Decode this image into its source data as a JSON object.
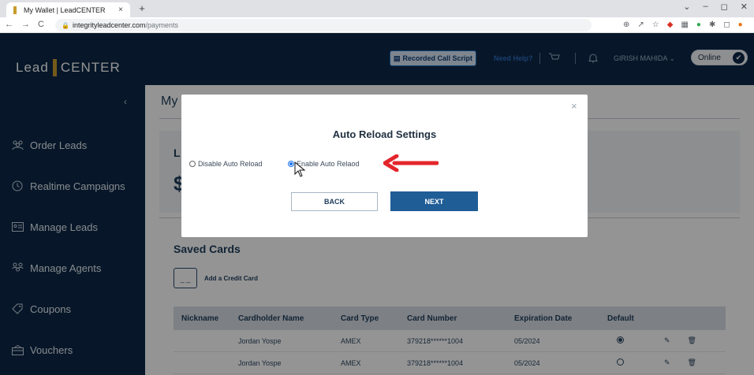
{
  "browser": {
    "tab_title": "My Wallet | LeadCENTER",
    "tab_close": "×",
    "new_tab": "+",
    "url_domain": "integrityleadcenter.com",
    "url_path": "/payments",
    "window_controls": [
      "⌄",
      "–",
      "◻",
      "✕"
    ]
  },
  "sidebar": {
    "logo_left": "Lead",
    "logo_right": "CENTER",
    "collapse_glyph": "‹",
    "items": [
      {
        "label": "Order Leads",
        "icon": "order-leads-icon"
      },
      {
        "label": "Realtime Campaigns",
        "icon": "clock-icon"
      },
      {
        "label": "Manage Leads",
        "icon": "contact-card-icon"
      },
      {
        "label": "Manage Agents",
        "icon": "agents-icon"
      },
      {
        "label": "Coupons",
        "icon": "tag-icon"
      },
      {
        "label": "Vouchers",
        "icon": "voucher-icon"
      }
    ]
  },
  "topbar": {
    "recorded_call_script": "Recorded Call Script",
    "need_help": "Need Help?",
    "user_name": "GIRISH MAHIDA",
    "status": "Online"
  },
  "main": {
    "page_title": "My",
    "wallet_label": "L",
    "wallet_amount": "$",
    "saved_cards_title": "Saved Cards",
    "add_card_label": "Add a Credit Card",
    "add_card_icon_text": "_ _",
    "table": {
      "headers": [
        "Nickname",
        "Cardholder Name",
        "Card Type",
        "Card Number",
        "Expiration Date",
        "Default"
      ],
      "rows": [
        {
          "nickname": "",
          "holder": "Jordan Yospe",
          "type": "AMEX",
          "number": "379218******1004",
          "expiration": "05/2024",
          "default": true
        },
        {
          "nickname": "",
          "holder": "Jordan Yospe",
          "type": "AMEX",
          "number": "379218******1004",
          "expiration": "05/2024",
          "default": false
        }
      ]
    }
  },
  "modal": {
    "title": "Auto Reload Settings",
    "close_glyph": "×",
    "option_disable": "Disable Auto Reload",
    "option_enable": "Enable Auto Relaod",
    "selected": "enable",
    "back_label": "BACK",
    "next_label": "NEXT"
  },
  "colors": {
    "sidebar_bg": "#0d2847",
    "accent_gold": "#c99b2e",
    "primary_button": "#1f5d96",
    "annotation_arrow": "#e3262b"
  }
}
